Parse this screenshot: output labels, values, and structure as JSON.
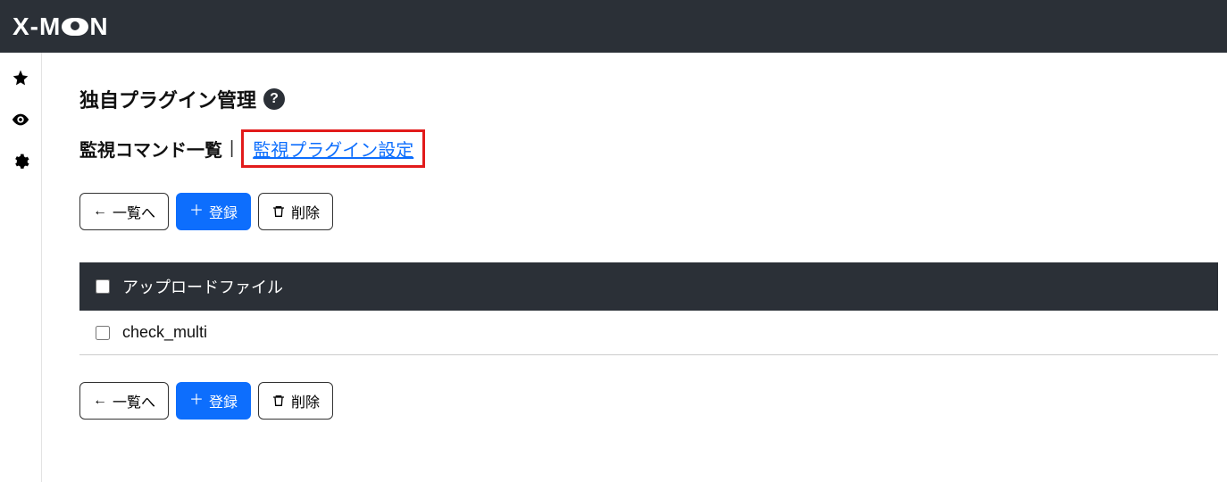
{
  "app": {
    "logo_prefix": "X-M",
    "logo_suffix": "N"
  },
  "page": {
    "title": "独自プラグイン管理",
    "help_label": "?"
  },
  "breadcrumb": {
    "current": "監視コマンド一覧",
    "divider": "|",
    "link": "監視プラグイン設定"
  },
  "toolbar": {
    "back_label": "一覧へ",
    "register_label": "登録",
    "delete_label": "削除"
  },
  "table": {
    "header_label": "アップロードファイル",
    "rows": [
      {
        "name": "check_multi"
      }
    ]
  }
}
